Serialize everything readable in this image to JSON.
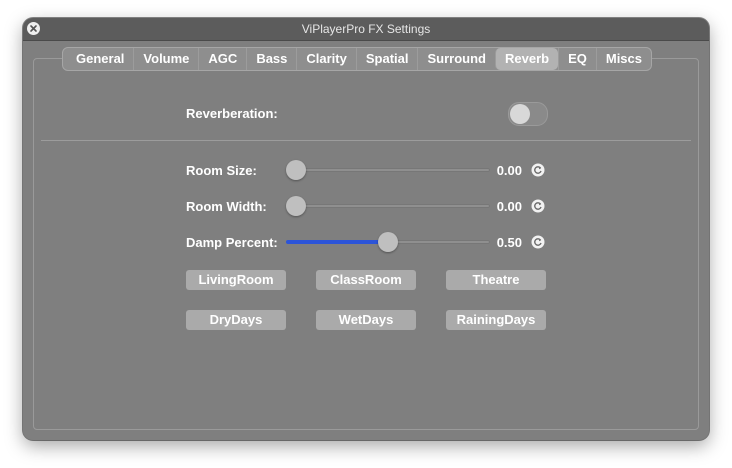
{
  "window": {
    "title": "ViPlayerPro FX Settings"
  },
  "tabs": [
    {
      "label": "General"
    },
    {
      "label": "Volume"
    },
    {
      "label": "AGC"
    },
    {
      "label": "Bass"
    },
    {
      "label": "Clarity"
    },
    {
      "label": "Spatial"
    },
    {
      "label": "Surround"
    },
    {
      "label": "Reverb"
    },
    {
      "label": "EQ"
    },
    {
      "label": "Miscs"
    }
  ],
  "active_tab": "Reverb",
  "reverb": {
    "label": "Reverberation:",
    "enabled": false
  },
  "sliders": [
    {
      "label": "Room Size:",
      "value": "0.00",
      "fraction": 0.0
    },
    {
      "label": "Room Width:",
      "value": "0.00",
      "fraction": 0.0
    },
    {
      "label": "Damp Percent:",
      "value": "0.50",
      "fraction": 0.5
    }
  ],
  "presets": [
    {
      "label": "LivingRoom"
    },
    {
      "label": "ClassRoom"
    },
    {
      "label": "Theatre"
    },
    {
      "label": "DryDays"
    },
    {
      "label": "WetDays"
    },
    {
      "label": "RainingDays"
    }
  ],
  "colors": {
    "accent": "#2c54d8",
    "window_bg": "#7f7f7f"
  }
}
